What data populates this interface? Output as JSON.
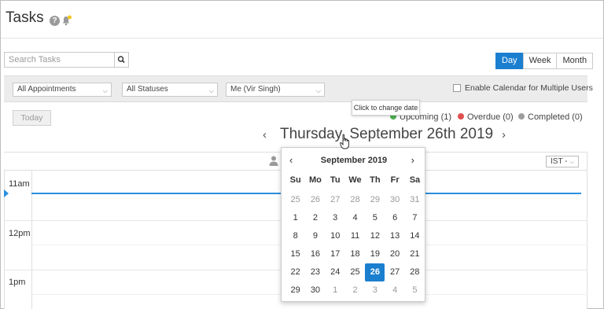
{
  "header": {
    "title": "Tasks"
  },
  "search": {
    "placeholder": "Search Tasks"
  },
  "views": [
    "Day",
    "Week",
    "Month"
  ],
  "filters": {
    "appointments": "All Appointments",
    "statuses": "All Statuses",
    "user": "Me (Vir Singh)",
    "multi_user_label": "Enable Calendar for Multiple Users"
  },
  "today_label": "Today",
  "tooltip": "Click to change date",
  "legend": [
    {
      "label": "Upcoming (1)",
      "color": "#4caf50"
    },
    {
      "label": "Overdue (0)",
      "color": "#e05050"
    },
    {
      "label": "Completed (0)",
      "color": "#9e9e9e"
    }
  ],
  "date_nav": {
    "prev": "‹",
    "title": "Thursday, September 26th 2019",
    "next": "›"
  },
  "timezone": "IST -",
  "times": [
    "11am",
    "12pm",
    "1pm"
  ],
  "datepicker": {
    "month": "September 2019",
    "prev": "‹",
    "next": "›",
    "weekdays": [
      "Su",
      "Mo",
      "Tu",
      "We",
      "Th",
      "Fr",
      "Sa"
    ],
    "days": [
      [
        "25",
        "26",
        "27",
        "28",
        "29",
        "30",
        "31"
      ],
      [
        "1",
        "2",
        "3",
        "4",
        "5",
        "6",
        "7"
      ],
      [
        "8",
        "9",
        "10",
        "11",
        "12",
        "13",
        "14"
      ],
      [
        "15",
        "16",
        "17",
        "18",
        "19",
        "20",
        "21"
      ],
      [
        "22",
        "23",
        "24",
        "25",
        "26",
        "27",
        "28"
      ],
      [
        "29",
        "30",
        "1",
        "2",
        "3",
        "4",
        "5"
      ]
    ],
    "selected": "26"
  },
  "colors": {
    "accent": "#1b7fd0",
    "now_line": "#2a8fde"
  }
}
